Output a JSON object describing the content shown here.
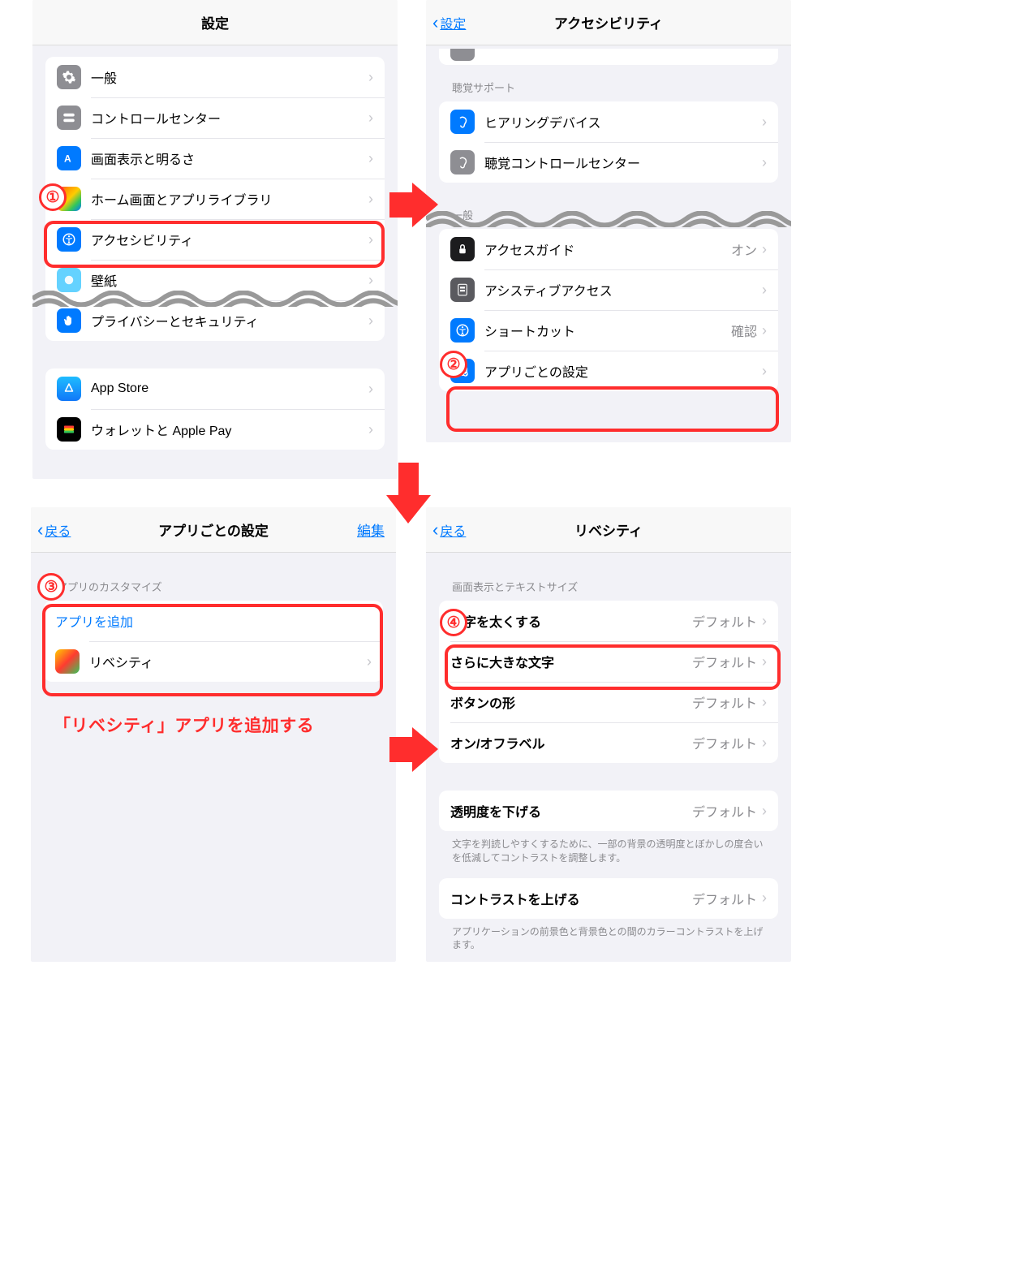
{
  "panel1": {
    "title": "設定",
    "rows": {
      "general": "一般",
      "control_center": "コントロールセンター",
      "display": "画面表示と明るさ",
      "home": "ホーム画面とアプリライブラリ",
      "accessibility": "アクセシビリティ",
      "wallpaper": "壁紙",
      "privacy": "プライバシーとセキュリティ",
      "appstore": "App Store",
      "wallet": "ウォレットと Apple Pay"
    }
  },
  "panel2": {
    "back": "設定",
    "title": "アクセシビリティ",
    "hearing_header": "聴覚サポート",
    "rows": {
      "hearing_devices": "ヒアリングデバイス",
      "audio_control": "聴覚コントロールセンター"
    },
    "general_header": "一般",
    "rows2": {
      "guided_access": {
        "label": "アクセスガイド",
        "value": "オン"
      },
      "assistive": "アシスティブアクセス",
      "shortcut": {
        "label": "ショートカット",
        "value": "確認"
      },
      "per_app": "アプリごとの設定"
    }
  },
  "panel3": {
    "back": "戻る",
    "title": "アプリごとの設定",
    "edit": "編集",
    "section": "アプリのカスタマイズ",
    "add": "アプリを追加",
    "libecity": "リベシティ",
    "caption": "「リベシティ」アプリを追加する"
  },
  "panel4": {
    "back": "戻る",
    "title": "リベシティ",
    "section": "画面表示とテキストサイズ",
    "rows": {
      "bold": {
        "label": "文字を太くする",
        "value": "デフォルト"
      },
      "larger": {
        "label": "さらに大きな文字",
        "value": "デフォルト"
      },
      "button_shapes": {
        "label": "ボタンの形",
        "value": "デフォルト"
      },
      "on_off": {
        "label": "オン/オフラベル",
        "value": "デフォルト"
      },
      "reduce_transparency": {
        "label": "透明度を下げる",
        "value": "デフォルト"
      },
      "increase_contrast": {
        "label": "コントラストを上げる",
        "value": "デフォルト"
      }
    },
    "footer1": "文字を判読しやすくするために、一部の背景の透明度とぼかしの度合いを低減してコントラストを調整します。",
    "footer2": "アプリケーションの前景色と背景色との間のカラーコントラストを上げます。"
  }
}
